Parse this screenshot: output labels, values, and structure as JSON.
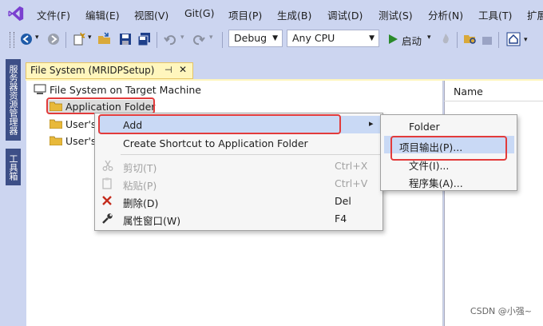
{
  "menubar": {
    "items": [
      "文件(F)",
      "编辑(E)",
      "视图(V)",
      "Git(G)",
      "项目(P)",
      "生成(B)",
      "调试(D)",
      "测试(S)",
      "分析(N)",
      "工具(T)",
      "扩展"
    ]
  },
  "toolbar": {
    "configuration": "Debug",
    "platform": "Any CPU",
    "start_label": "启动"
  },
  "side_tabs": {
    "server_explorer": "服务器资源管理器",
    "toolbox": "工具箱"
  },
  "document_tab": {
    "title": "File System (MRIDPSetup)",
    "pin": "⊣",
    "close": "✕"
  },
  "tree": {
    "root": "File System on Target Machine",
    "items": [
      "Application Folder",
      "User's",
      "User's"
    ]
  },
  "right_panel": {
    "column_header": "Name"
  },
  "context_menu": {
    "items": [
      {
        "label": "Add",
        "shortcut": "",
        "arrow": "▸"
      },
      {
        "label": "Create Shortcut to Application Folder",
        "shortcut": ""
      },
      {
        "label": "剪切(T)",
        "shortcut": "Ctrl+X"
      },
      {
        "label": "粘贴(P)",
        "shortcut": "Ctrl+V"
      },
      {
        "label": "删除(D)",
        "shortcut": "Del"
      },
      {
        "label": "属性窗口(W)",
        "shortcut": "F4"
      }
    ]
  },
  "submenu": {
    "items": [
      "Folder",
      "项目输出(P)...",
      "文件(I)...",
      "程序集(A)..."
    ]
  },
  "watermark": "CSDN @小强~",
  "colors": {
    "highlight": "#c9d9f5",
    "callout": "#e23b3b",
    "tab": "#fff6bd",
    "chrome": "#ccd5f0"
  }
}
